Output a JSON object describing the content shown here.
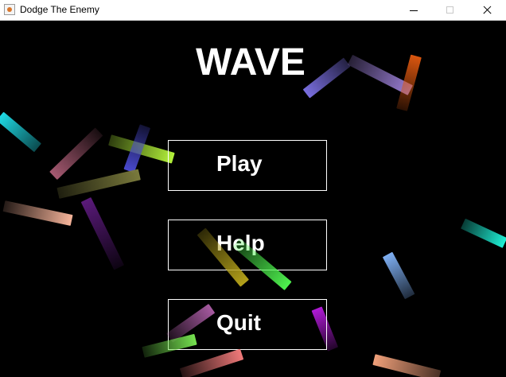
{
  "window": {
    "title": "Dodge The Enemy",
    "icon": "java-app-icon",
    "controls": [
      "minimize",
      "maximize",
      "close"
    ]
  },
  "game": {
    "heading": "WAVE",
    "menu": [
      {
        "id": "play",
        "label": "Play"
      },
      {
        "id": "help",
        "label": "Help"
      },
      {
        "id": "quit",
        "label": "Quit"
      }
    ]
  },
  "colors": {
    "background": "#000000",
    "text": "#ffffff",
    "button_border": "#ffffff",
    "enemy_palette": [
      "#7a6fe0",
      "#9b7fd6",
      "#d9560f",
      "#1fd9e4",
      "#a65a72",
      "#b3f23a",
      "#4a4ad0",
      "#7a7a3c",
      "#f6b49a",
      "#5a1a7a",
      "#b4a11a",
      "#4ef24e",
      "#f07a7a",
      "#b01ad6",
      "#1ef0d6",
      "#7fb0f4"
    ]
  }
}
